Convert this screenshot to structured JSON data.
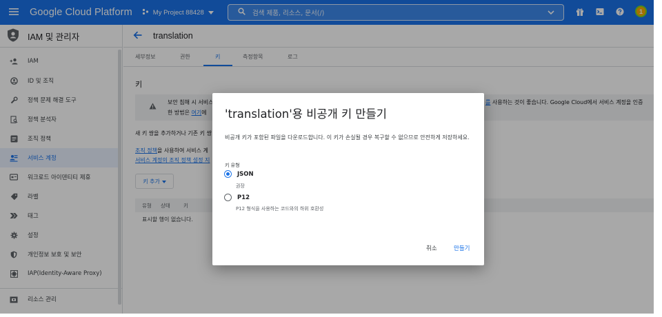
{
  "topbar": {
    "brand": "Google Cloud Platform",
    "project": "My Project 88428",
    "search_placeholder": "검색  제품, 리소스, 문서(/)",
    "avatar_letter": "1",
    "color": "#1a73e8"
  },
  "sidebar": {
    "title": "IAM 및 관리자",
    "items": [
      {
        "label": "IAM",
        "icon": "person-add-icon"
      },
      {
        "label": "ID 및 조직",
        "icon": "account-circle-icon"
      },
      {
        "label": "정책 문제 해결 도구",
        "icon": "wrench-icon"
      },
      {
        "label": "정책 분석자",
        "icon": "document-search-icon"
      },
      {
        "label": "조직 정책",
        "icon": "list-box-icon"
      },
      {
        "label": "서비스 계정",
        "icon": "service-account-icon"
      },
      {
        "label": "워크로드 아이덴티티 제휴",
        "icon": "id-card-icon"
      },
      {
        "label": "라벨",
        "icon": "label-icon"
      },
      {
        "label": "태그",
        "icon": "tag-icon"
      },
      {
        "label": "설정",
        "icon": "gear-icon"
      },
      {
        "label": "개인정보 보호 및 보안",
        "icon": "shield-icon"
      },
      {
        "label": "IAP(Identity-Aware Proxy)",
        "icon": "iap-icon"
      },
      {
        "label": "리소스 관리",
        "icon": "folder-icon"
      }
    ]
  },
  "main": {
    "page_title": "translation",
    "tabs": [
      "세부정보",
      "권한",
      "키",
      "측정항목",
      "로그"
    ],
    "section_title": "키",
    "banner": {
      "line1": "보안 침해 시 서비스",
      "line2a": "한 방법은 ",
      "line2_link": "여기",
      "line2b": "에",
      "tail_link": "를",
      "tail": " 사용하는 것이 좋습니다. Google Cloud에서 서비스 계정을 인증"
    },
    "desc1": "새 키 쌍을 추가하거나 기존 키 쌍",
    "desc2_link": "조직 정책",
    "desc2": "을 사용하여 서비스 계",
    "desc3_link": "서비스 계정의 조직 정책 설정 지",
    "add_key_label": "키 추가",
    "table_columns": [
      "유형",
      "상태",
      "키"
    ],
    "empty_text": "표시할 행이 없습니다."
  },
  "dialog": {
    "title": "'translation'용 비공개 키 만들기",
    "description": "비공개 키가 포함된 파일을 다운로드합니다. 이 키가 손실될 경우 복구할 수 없으므로 안전하게 저장하세요.",
    "key_type_label": "키 유형",
    "options": [
      {
        "label": "JSON",
        "sub": "권장",
        "checked": true
      },
      {
        "label": "P12",
        "sub": "P12 형식을 사용하는 코드와의 하위 호환성",
        "checked": false
      }
    ],
    "cancel_label": "취소",
    "create_label": "만들기"
  }
}
